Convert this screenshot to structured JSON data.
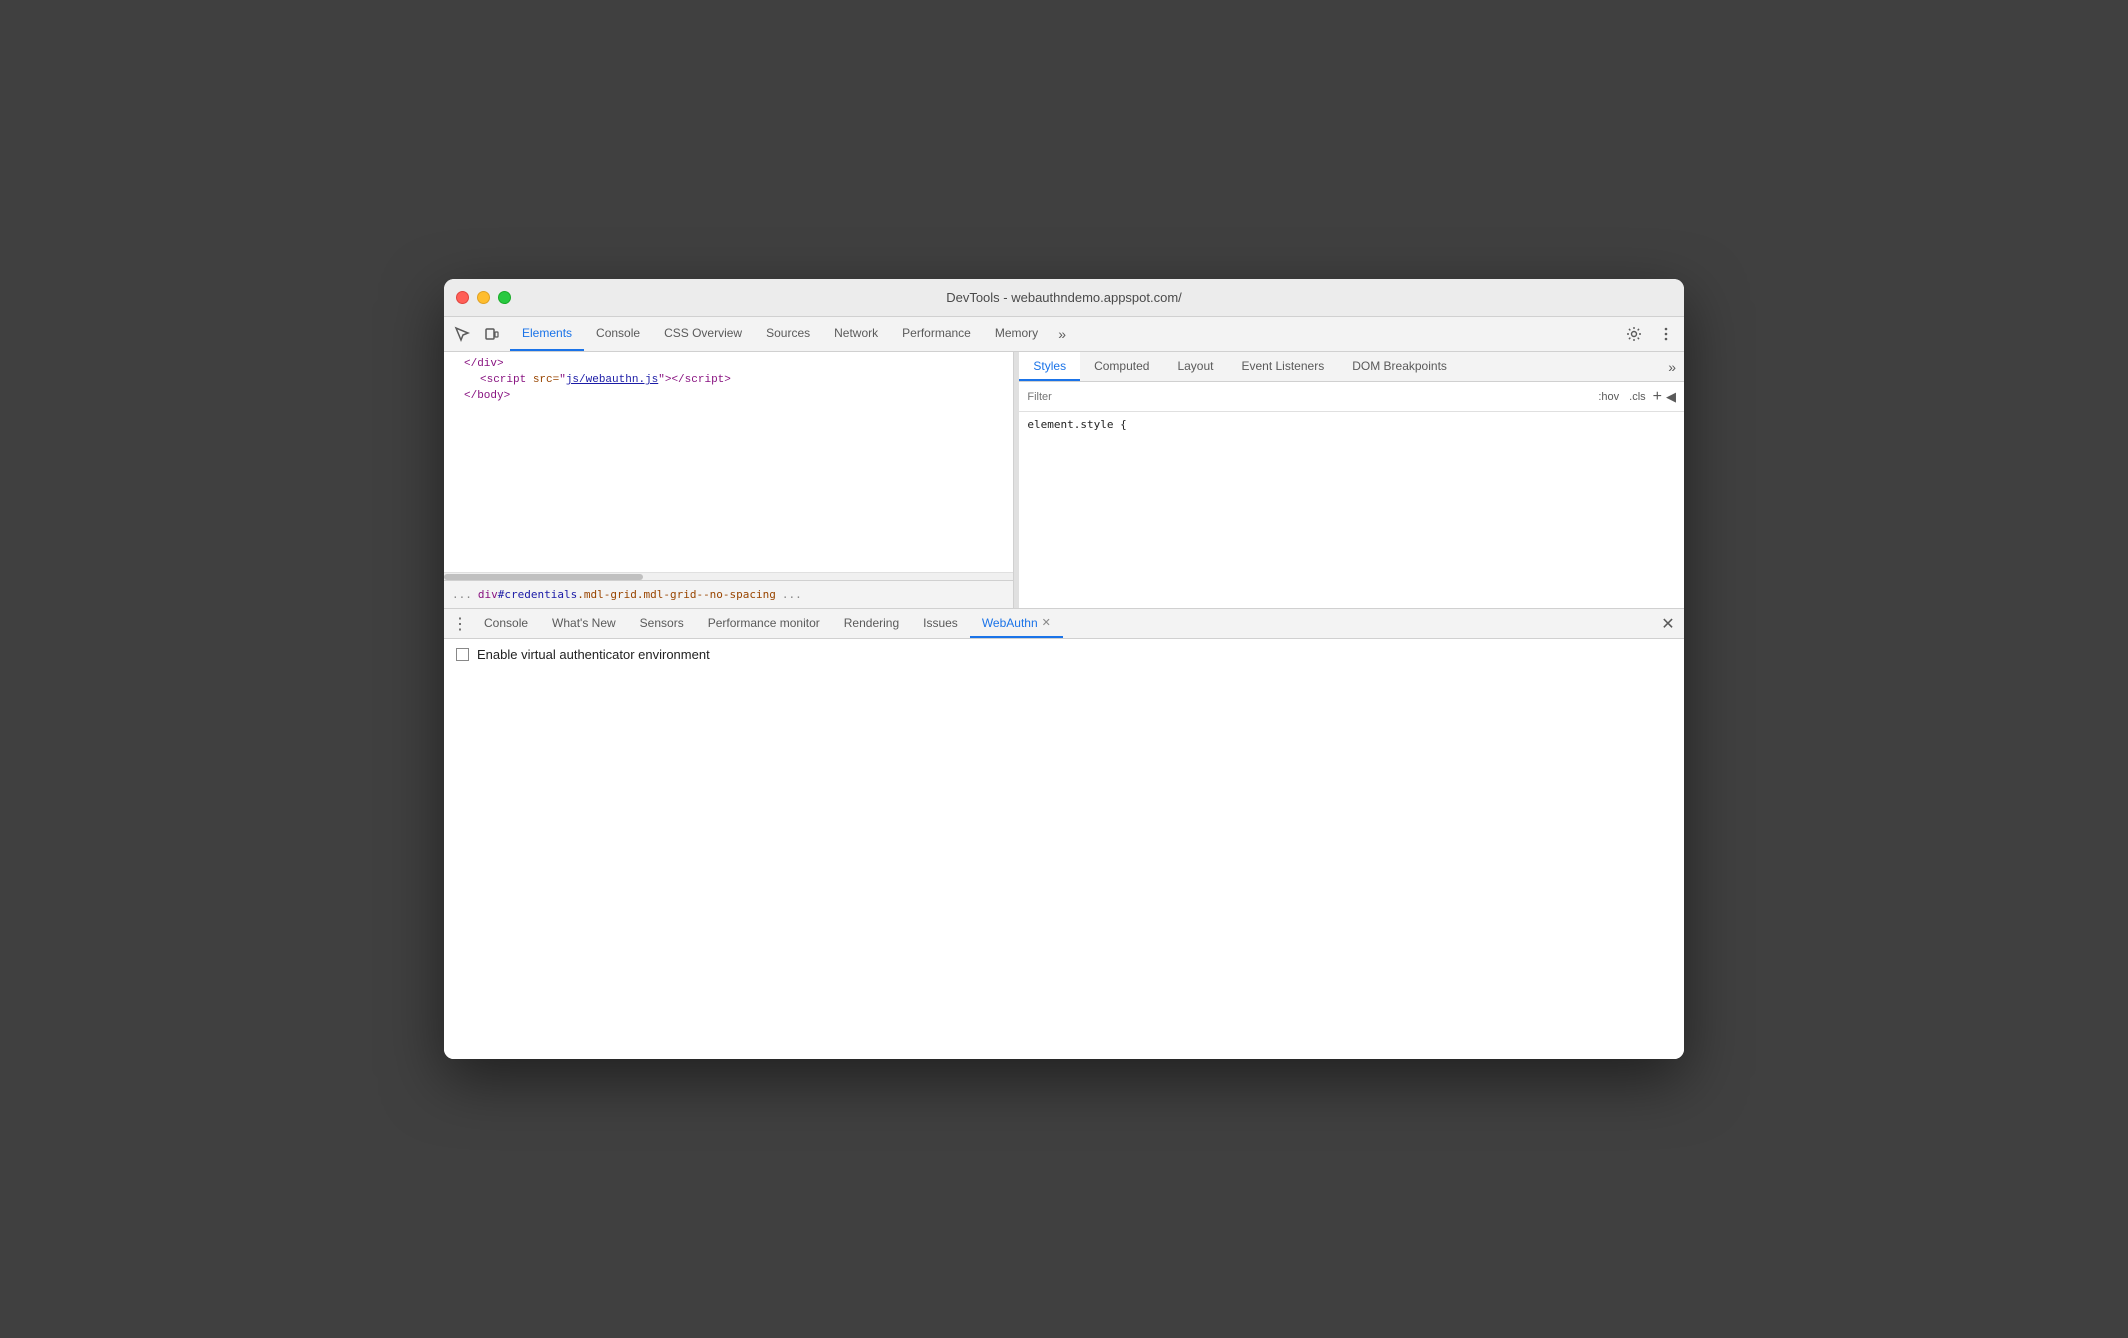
{
  "window": {
    "title": "DevTools - webauthndemo.appspot.com/"
  },
  "toolbar": {
    "tabs": [
      {
        "label": "Elements",
        "active": true
      },
      {
        "label": "Console",
        "active": false
      },
      {
        "label": "CSS Overview",
        "active": false
      },
      {
        "label": "Sources",
        "active": false
      },
      {
        "label": "Network",
        "active": false
      },
      {
        "label": "Performance",
        "active": false
      },
      {
        "label": "Memory",
        "active": false
      }
    ],
    "more_label": "»"
  },
  "elements": {
    "lines": [
      {
        "html": "</div>"
      },
      {
        "html": "<script src=\"js/webauthn.js\"></script>"
      },
      {
        "html": "</body>"
      }
    ]
  },
  "breadcrumb": {
    "dots": "...",
    "text": "div#credentials.mdl-grid.mdl-grid--no-spacing",
    "more": "..."
  },
  "styles": {
    "tabs": [
      {
        "label": "Styles",
        "active": true
      },
      {
        "label": "Computed",
        "active": false
      },
      {
        "label": "Layout",
        "active": false
      },
      {
        "label": "Event Listeners",
        "active": false
      },
      {
        "label": "DOM Breakpoints",
        "active": false
      }
    ],
    "filter_placeholder": "Filter",
    "filter_hov": ":hov",
    "filter_cls": ".cls",
    "filter_plus": "+",
    "rule": "element.style {"
  },
  "bottom": {
    "tabs": [
      {
        "label": "Console",
        "closeable": false
      },
      {
        "label": "What's New",
        "closeable": false
      },
      {
        "label": "Sensors",
        "closeable": false
      },
      {
        "label": "Performance monitor",
        "closeable": false
      },
      {
        "label": "Rendering",
        "closeable": false
      },
      {
        "label": "Issues",
        "closeable": false
      },
      {
        "label": "WebAuthn",
        "closeable": true,
        "active": true
      }
    ],
    "webauthn": {
      "checkbox_label": "Enable virtual authenticator environment"
    }
  }
}
